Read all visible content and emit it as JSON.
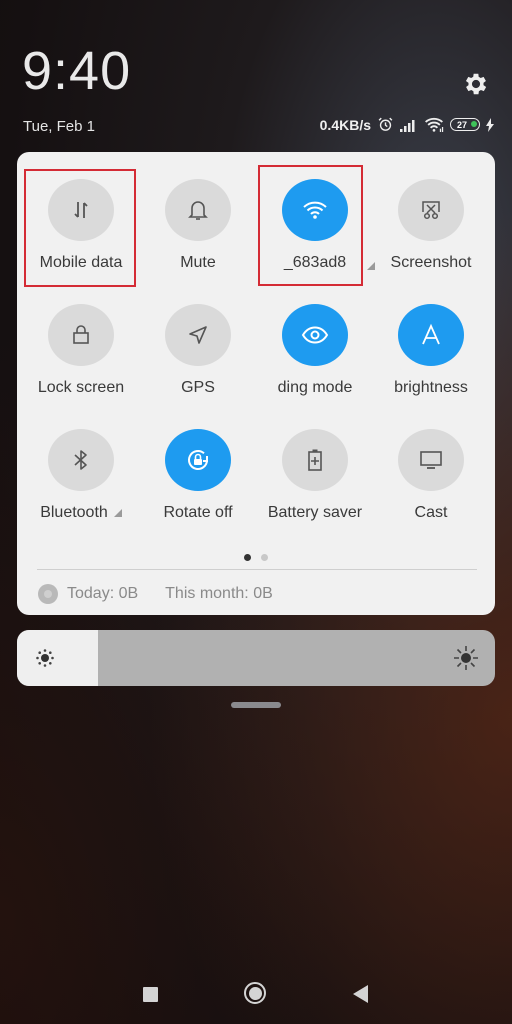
{
  "lockscreen": {
    "time": "9:40",
    "date": "Tue, Feb 1"
  },
  "status_bar": {
    "network_speed": "0.4KB/s",
    "icons": [
      "alarm-icon",
      "signal-icon",
      "wifi-icon",
      "battery-icon",
      "charging-icon"
    ],
    "battery_level": "27",
    "battery_charging": true
  },
  "settings": {
    "icon": "gear-icon"
  },
  "quick_settings": {
    "tiles": [
      {
        "label": "Mobile data",
        "icon": "mobile-data-icon",
        "active": false,
        "highlighted": true,
        "has_menu": false
      },
      {
        "label": "Mute",
        "icon": "bell-icon",
        "active": false,
        "highlighted": false,
        "has_menu": false
      },
      {
        "label": "_683ad8",
        "icon": "wifi-icon",
        "active": true,
        "highlighted": true,
        "has_menu": true
      },
      {
        "label": "Screenshot",
        "icon": "screenshot-icon",
        "active": false,
        "highlighted": false,
        "has_menu": false
      },
      {
        "label": "Lock screen",
        "icon": "lock-icon",
        "active": false,
        "highlighted": false,
        "has_menu": false
      },
      {
        "label": "GPS",
        "icon": "location-arrow-icon",
        "active": false,
        "highlighted": false,
        "has_menu": false
      },
      {
        "label": "ding mode",
        "icon": "eye-icon",
        "active": true,
        "highlighted": false,
        "has_menu": false
      },
      {
        "label": "brightness",
        "icon": "auto-brightness-icon",
        "active": true,
        "highlighted": false,
        "has_menu": false
      },
      {
        "label": "Bluetooth",
        "icon": "bluetooth-icon",
        "active": false,
        "highlighted": false,
        "has_menu": true
      },
      {
        "label": "Rotate off",
        "icon": "rotate-lock-icon",
        "active": true,
        "highlighted": false,
        "has_menu": false
      },
      {
        "label": "Battery saver",
        "icon": "battery-saver-icon",
        "active": false,
        "highlighted": false,
        "has_menu": false
      },
      {
        "label": "Cast",
        "icon": "cast-icon",
        "active": false,
        "highlighted": false,
        "has_menu": false
      }
    ],
    "page_indicator": {
      "current": 1,
      "total": 2
    },
    "data_usage": {
      "today": "Today: 0B",
      "month": "This month: 0B"
    }
  },
  "brightness": {
    "level_percent": 17,
    "low_icon": "brightness-low-icon",
    "high_icon": "brightness-high-icon"
  },
  "navigation": {
    "recents": "recents-button",
    "home": "home-button",
    "back": "back-button"
  },
  "colors": {
    "accent": "#1e9bf0",
    "tile_off": "#dadada",
    "panel_bg": "#f1f1f1",
    "highlight_box": "#d42b35"
  }
}
